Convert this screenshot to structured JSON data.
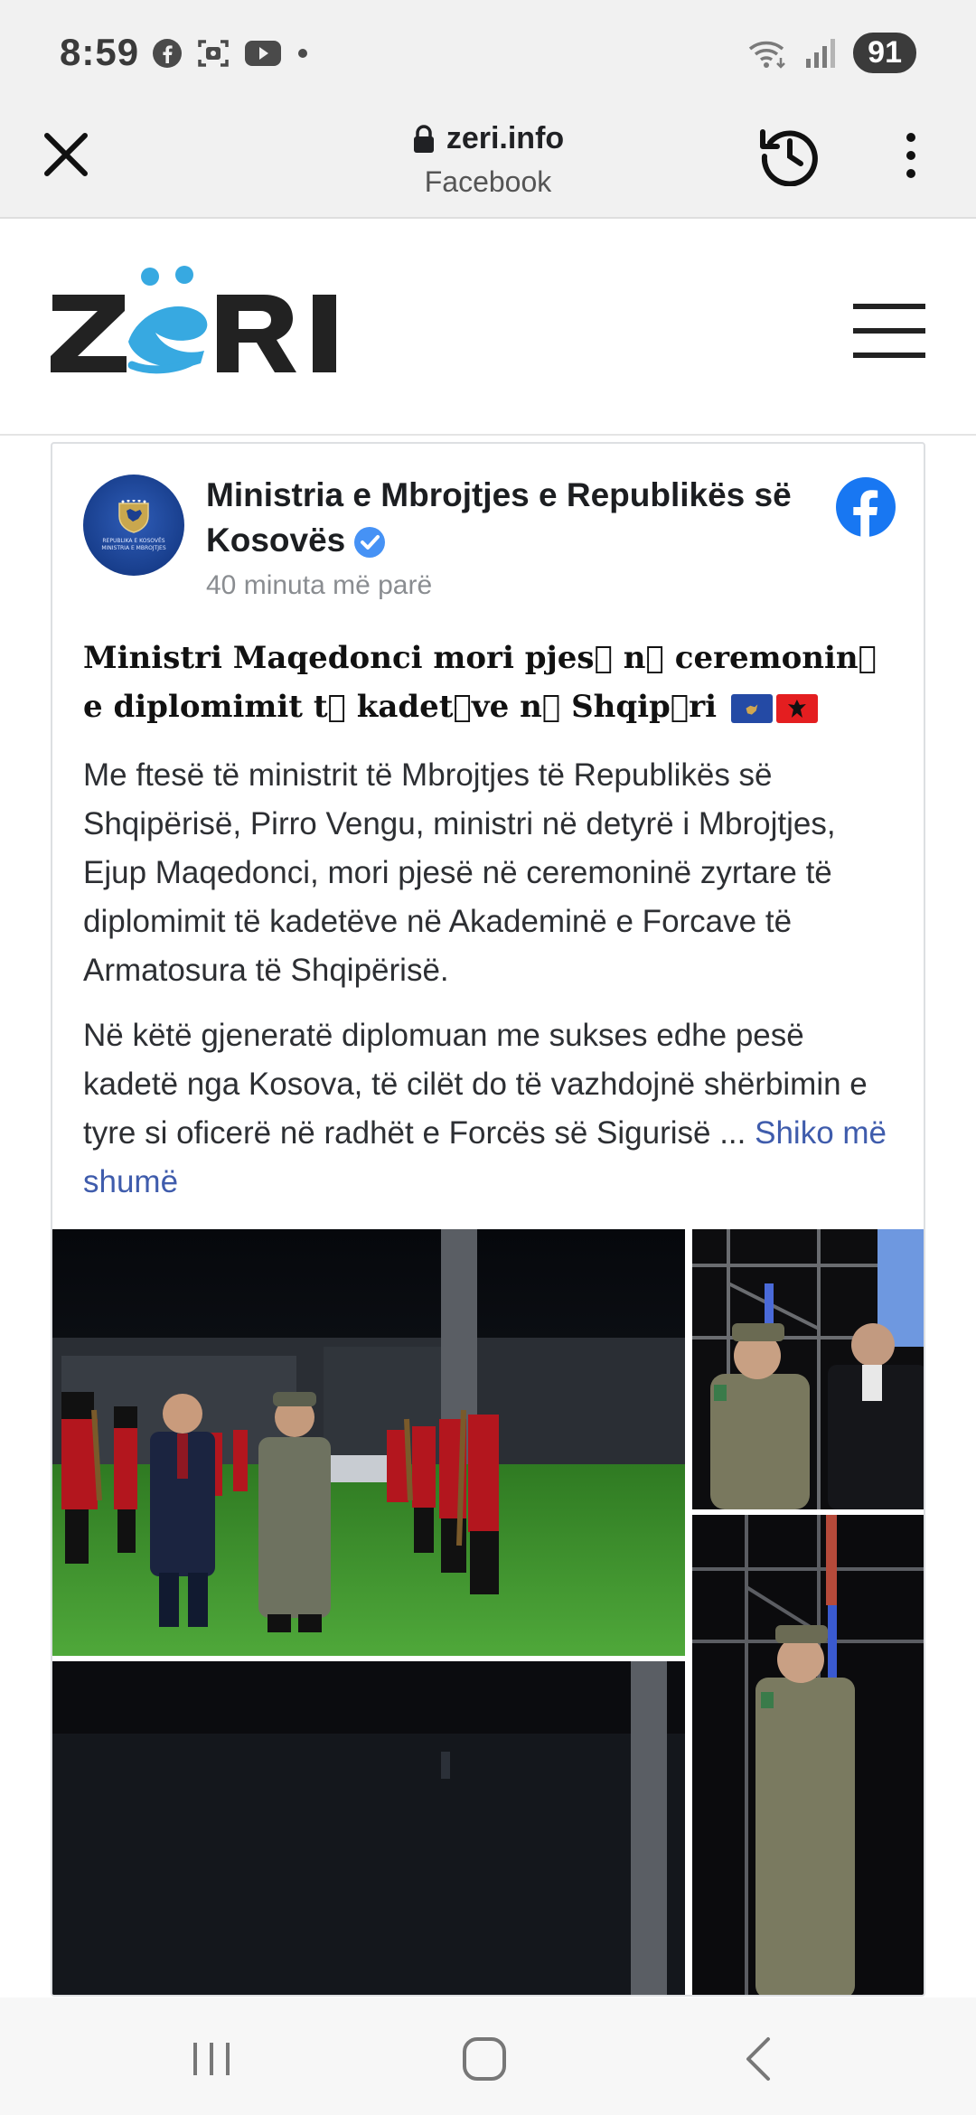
{
  "status_bar": {
    "time": "8:59",
    "icons_left": [
      "facebook-icon",
      "screenshot-icon",
      "youtube-icon",
      "dot-icon"
    ],
    "icons_right": [
      "wifi-icon",
      "signal-icon"
    ],
    "battery": "91"
  },
  "browser": {
    "domain": "zeri.info",
    "source": "Facebook",
    "icons": [
      "close-icon",
      "lock-icon",
      "history-icon",
      "more-vertical-icon"
    ]
  },
  "site": {
    "logo_text": "ZËRI",
    "logo_colors": {
      "dark": "#222222",
      "accent": "#37a9e1"
    }
  },
  "post": {
    "page_name": "Ministria e Mbrojtjes e Republikës së Kosovës",
    "verified": true,
    "time": "40 minuta më parë",
    "avatar_text": "REPUBLIKA E KOSOVËS MINISTRIA E MBROJTJES",
    "title": "Ministri Maqedonci mori pjes\u0000 n\u0000 ceremonin\u0000 e diplomimit t\u0000 kadet\u0000ve n\u0000 Shqip\u0000ri",
    "title_display": "Ministri Maqedonci mori pjes⃞ n⃞ ceremonin⃞ e diplomimit t⃞ kadet⃞ve n⃞ Shqip⃞ri",
    "title_flags": [
      "kosovo-flag",
      "albania-flag"
    ],
    "paragraph_1": "Me ftesë të ministrit të Mbrojtjes të Republikës së Shqipërisë, Pirro Vengu, ministri në detyrë i Mbrojtjes, Ejup Maqedonci, mori pjesë në ceremoninë zyrtare të diplomimit të kadetëve në Akademinë e Forcave të Armatosura të Shqipërisë.",
    "paragraph_2": "Në këtë gjeneratë diplomuan me sukses edhe pesë kadetë nga Kosova, të cilët do të vazhdojnë shërbimin e tyre si oficerë në radhët e Forcës së Sigurisë ...",
    "see_more": "Shiko më shumë",
    "link_color": "#3f5cac"
  },
  "nav": {
    "icons": [
      "recent-apps-icon",
      "home-icon",
      "back-icon"
    ]
  }
}
